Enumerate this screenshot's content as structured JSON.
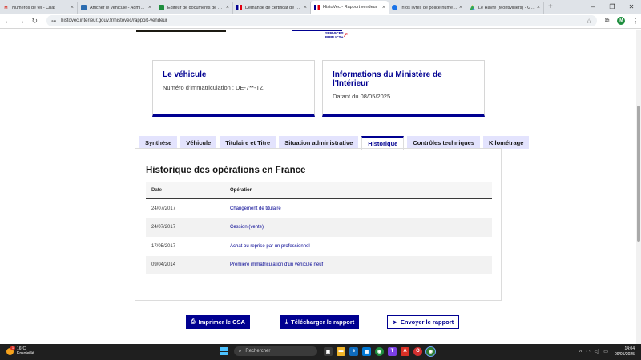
{
  "browser": {
    "tabs": [
      {
        "title": "Numéros de tél - Chat",
        "favicon": "gmail-icon"
      },
      {
        "title": "Afficher le véhicule - Admin Co",
        "favicon": "admin-icon"
      },
      {
        "title": "Editeur de documents de vach",
        "favicon": "sheets-icon"
      },
      {
        "title": "Demande de certificat de situ",
        "favicon": "french-flag-icon"
      },
      {
        "title": "HistoVec - Rapport vendeur",
        "favicon": "french-flag-icon",
        "active": true
      },
      {
        "title": "Infos livres de police numériqu",
        "favicon": "info-icon"
      },
      {
        "title": "Le Havre (Montivilliers) - Goog",
        "favicon": "drive-icon"
      }
    ],
    "new_tab": "+",
    "window_controls": {
      "minimize": "–",
      "maximize": "❐",
      "close": "✕"
    },
    "url": "histovec.interieur.gouv.fr/histovec/rapport-vendeur",
    "profile_initial": "M"
  },
  "header": {
    "services_publics": "SERVICES\nPUBLICS+"
  },
  "cards": {
    "vehicle": {
      "title": "Le véhicule",
      "text": "Numéro d'immatriculation : DE-7**-TZ"
    },
    "ministry": {
      "title": "Informations du Ministère de l'Intérieur",
      "text": "Datant du 08/05/2025"
    }
  },
  "tabs": [
    {
      "label": "Synthèse"
    },
    {
      "label": "Véhicule"
    },
    {
      "label": "Titulaire et Titre"
    },
    {
      "label": "Situation administrative"
    },
    {
      "label": "Historique",
      "active": true
    },
    {
      "label": "Contrôles techniques"
    },
    {
      "label": "Kilométrage"
    }
  ],
  "history": {
    "title": "Historique des opérations en France",
    "columns": {
      "date": "Date",
      "operation": "Opération"
    },
    "rows": [
      {
        "date": "24/07/2017",
        "operation": "Changement de titulaire"
      },
      {
        "date": "24/07/2017",
        "operation": "Cession (vente)"
      },
      {
        "date": "17/05/2017",
        "operation": "Achat ou reprise par un professionnel"
      },
      {
        "date": "09/04/2014",
        "operation": "Première immatriculation d'un véhicule neuf"
      }
    ]
  },
  "actions": {
    "print": "Imprimer le CSA",
    "download": "Télécharger le rapport",
    "send": "Envoyer le rapport"
  },
  "taskbar": {
    "weather_temp": "16°C",
    "weather_desc": "Ensoleillé",
    "weather_badge": "1",
    "search_placeholder": "Rechercher",
    "time": "14:04",
    "date": "09/05/2025"
  },
  "colors": {
    "primary": "#000091",
    "tab_bg": "#e3e3fd"
  }
}
